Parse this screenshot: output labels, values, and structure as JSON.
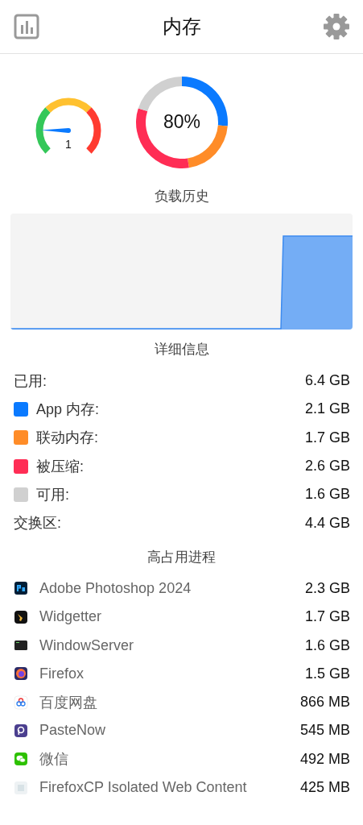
{
  "header": {
    "title": "内存"
  },
  "gauge": {
    "level": 0.17,
    "reading": "1"
  },
  "donut": {
    "label": "80%",
    "chart_data": {
      "type": "donut",
      "values": [
        26.25,
        21.25,
        32.5,
        20
      ]
    }
  },
  "history": {
    "title": "负载历史"
  },
  "details": {
    "title": "详细信息",
    "rows": [
      {
        "kind": "plain",
        "label": "已用:",
        "value": "6.4 GB"
      },
      {
        "kind": "swatch",
        "color": "#0a7aff",
        "label": "App 内存:",
        "value": "2.1 GB"
      },
      {
        "kind": "swatch",
        "color": "#ff8c28",
        "label": "联动内存:",
        "value": "1.7 GB"
      },
      {
        "kind": "swatch",
        "color": "#ff2d55",
        "label": "被压缩:",
        "value": "2.6 GB"
      },
      {
        "kind": "swatch",
        "color": "#d0d0d0",
        "label": "可用:",
        "value": "1.6 GB"
      },
      {
        "kind": "plain",
        "label": "交换区:",
        "value": "4.4 GB"
      }
    ]
  },
  "processes": {
    "title": "高占用进程",
    "rows": [
      {
        "name": "Adobe Photoshop 2024",
        "value": "2.3 GB"
      },
      {
        "name": "Widgetter",
        "value": "1.7 GB"
      },
      {
        "name": "WindowServer",
        "value": "1.6 GB"
      },
      {
        "name": "Firefox",
        "value": "1.5 GB"
      },
      {
        "name": "百度网盘",
        "value": "866 MB"
      },
      {
        "name": "PasteNow",
        "value": "545 MB"
      },
      {
        "name": "微信",
        "value": "492 MB"
      },
      {
        "name": "FirefoxCP Isolated Web Content",
        "value": "425 MB"
      }
    ]
  }
}
